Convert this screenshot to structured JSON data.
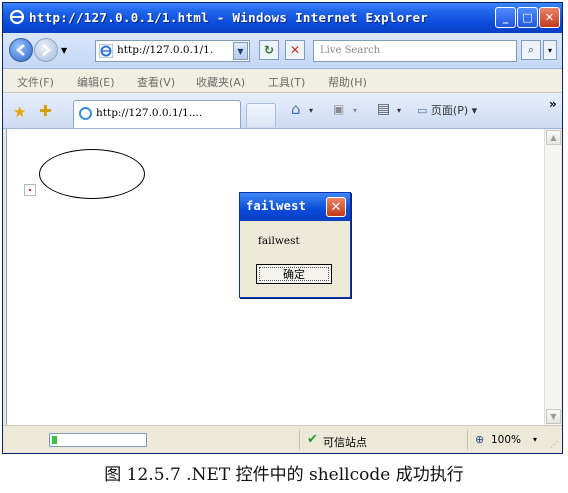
{
  "window": {
    "title": "http://127.0.0.1/1.html - Windows Internet Explorer",
    "minimize": "_",
    "maximize": "□",
    "close": "✕",
    "icon": "ie-icon"
  },
  "address_bar": {
    "back_icon": "back-arrow-icon",
    "forward_icon": "forward-arrow-icon",
    "url": "http://127.0.0.1/1.",
    "dropdown_glyph": "▼",
    "refresh_glyph": "↻",
    "stop_glyph": "✕"
  },
  "search": {
    "placeholder": "Live Search",
    "button_glyph": "⌕",
    "dropdown_glyph": "▾"
  },
  "menu": {
    "items": [
      "文件(F)",
      "编辑(E)",
      "查看(V)",
      "收藏夹(A)",
      "工具(T)",
      "帮助(H)"
    ]
  },
  "tabs": {
    "favorites_glyph": "★",
    "add_favorite_glyph": "✚",
    "items": [
      {
        "label": "http://127.0.0.1/1...."
      }
    ]
  },
  "commands": {
    "home_glyph": "⌂",
    "feeds_glyph": "▣",
    "print_glyph": "▤",
    "page_label": "页面(P)",
    "dropdown_glyph": "▾",
    "chevron": "»"
  },
  "dialog": {
    "title": "failwest",
    "close_glyph": "✕",
    "message": "failwest",
    "ok_label": "确定"
  },
  "scrollbar": {
    "up_glyph": "▲",
    "down_glyph": "▼"
  },
  "status": {
    "progress_fraction": 0.05,
    "zone_icon": "checkmark-icon",
    "zone_glyph": "✔",
    "zone_label": "可信站点",
    "zoom_glyph": "⊕",
    "zoom": "100%",
    "zoom_dropdown_glyph": "▾",
    "resize_grip_glyph": "⋰"
  },
  "caption": "图 12.5.7 .NET  控件中的 shellcode 成功执行",
  "colors": {
    "title_bar": "#0a4ad9",
    "window_frame": "#ece9d8",
    "close_button": "#c13a1a",
    "trusted_check": "#2f9a2f"
  }
}
